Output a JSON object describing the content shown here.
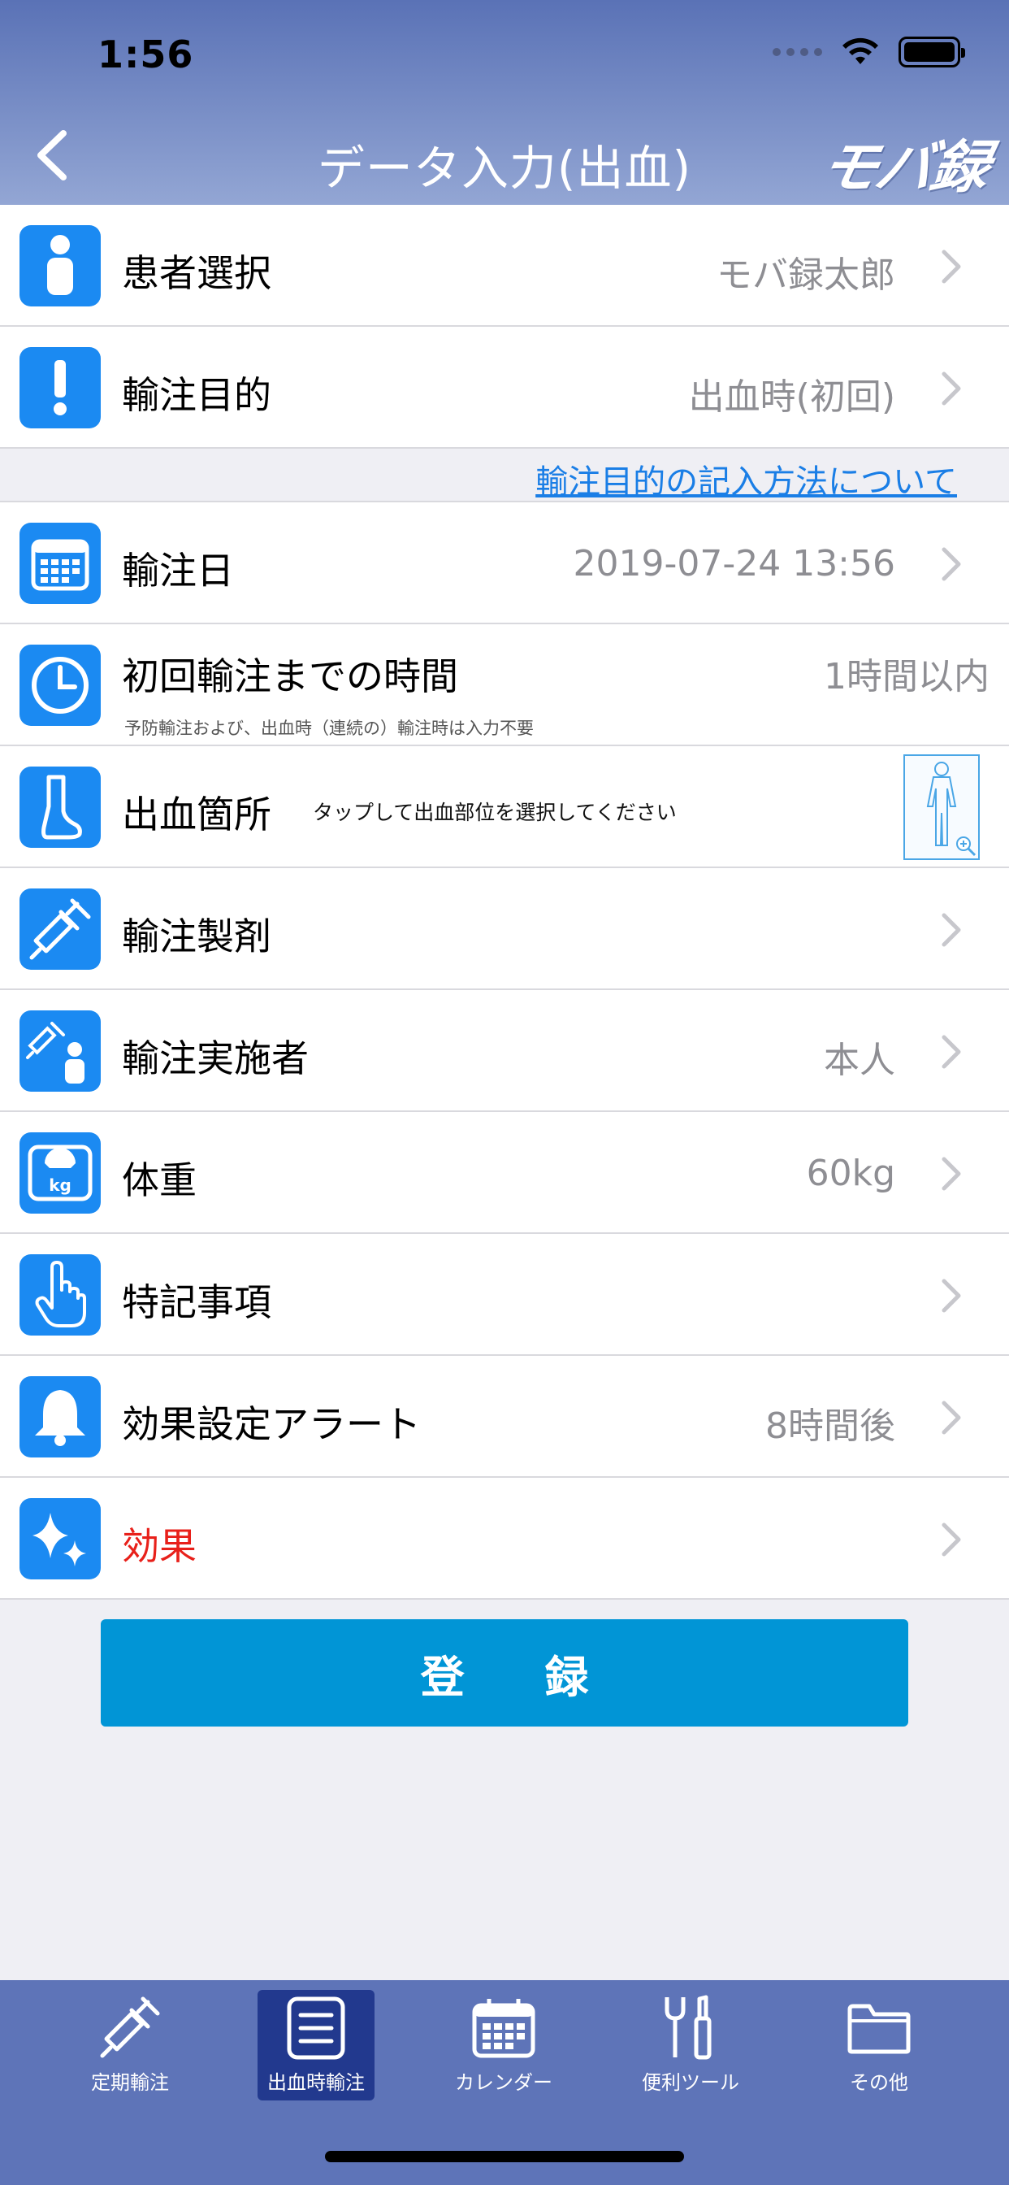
{
  "status_bar": {
    "time": "1:56"
  },
  "nav": {
    "title": "データ入力(出血)",
    "logo": "モバ録"
  },
  "rows": {
    "patient": {
      "label": "患者選択",
      "value": "モバ録太郎"
    },
    "purpose": {
      "label": "輸注目的",
      "value": "出血時(初回)"
    },
    "purpose_help_link": "輸注目的の記入方法について",
    "date": {
      "label": "輸注日",
      "value": "2019-07-24 13:56"
    },
    "time_to_first": {
      "label": "初回輸注までの時間",
      "value": "1時間以内",
      "sub": "予防輸注および、出血時（連続の）輸注時は入力不要"
    },
    "bleeding_site": {
      "label": "出血箇所",
      "hint": "タップして出血部位を選択してください"
    },
    "product": {
      "label": "輸注製剤"
    },
    "performer": {
      "label": "輸注実施者",
      "value": "本人"
    },
    "weight": {
      "label": "体重",
      "value": "60kg"
    },
    "notes": {
      "label": "特記事項"
    },
    "alert": {
      "label": "効果設定アラート",
      "value": "8時間後"
    },
    "effect": {
      "label": "効果"
    }
  },
  "register_button": "登 録",
  "tabs": [
    {
      "label": "定期輸注",
      "active": false
    },
    {
      "label": "出血時輸注",
      "active": true
    },
    {
      "label": "カレンダー",
      "active": false
    },
    {
      "label": "便利ツール",
      "active": false
    },
    {
      "label": "その他",
      "active": false
    }
  ],
  "colors": {
    "header_top": "#5a72b6",
    "icon_blue": "#1b8af2",
    "button": "#0195d6",
    "tabbar": "#5e74b8",
    "tab_active": "#22398e",
    "link": "#1a7ee6",
    "effect_red": "#e8201a"
  }
}
